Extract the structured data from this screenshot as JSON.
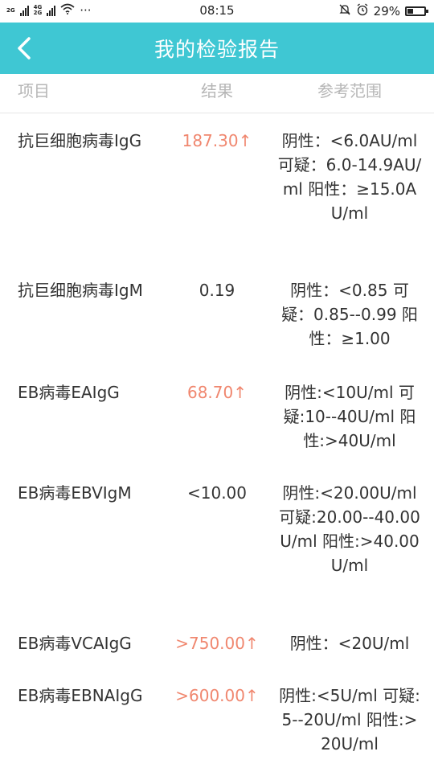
{
  "status_bar": {
    "network_labels": [
      "2G",
      "4G",
      "2G"
    ],
    "dots": "···",
    "time": "08:15",
    "battery": "29%",
    "battery_level": 0.29
  },
  "header": {
    "title": "我的检验报告",
    "back_icon": "chevron-left-icon",
    "bg_color": "#3fc7d3"
  },
  "table": {
    "columns": [
      "项目",
      "结果",
      "参考范围"
    ],
    "abnormal_color": "#f0876f",
    "rows": [
      {
        "name": "抗巨细胞病毒IgG",
        "result": "187.30↑",
        "abnormal": true,
        "range": "阴性：<6.0AU/ml 可疑：6.0-14.9AU/ml 阳性：≥15.0AU/ml"
      },
      {
        "name": "抗巨细胞病毒IgM",
        "result": "0.19",
        "abnormal": false,
        "range": "阴性：<0.85 可疑：0.85--0.99 阳性：≥1.00"
      },
      {
        "name": "EB病毒EAIgG",
        "result": "68.70↑",
        "abnormal": true,
        "range": "阴性:<10U/ml 可疑:10--40U/ml 阳性:>40U/ml"
      },
      {
        "name": "EB病毒EBVIgM",
        "result": "<10.00",
        "abnormal": false,
        "range": "阴性:<20.00U/ml 可疑:20.00--40.00U/ml 阳性:>40.00U/ml"
      },
      {
        "name": "EB病毒VCAIgG",
        "result": ">750.00↑",
        "abnormal": true,
        "range": "阴性：<20U/ml"
      },
      {
        "name": "EB病毒EBNAIgG",
        "result": ">600.00↑",
        "abnormal": true,
        "range": "阴性:<5U/ml 可疑:5--20U/ml 阳性:>20U/ml"
      }
    ]
  }
}
